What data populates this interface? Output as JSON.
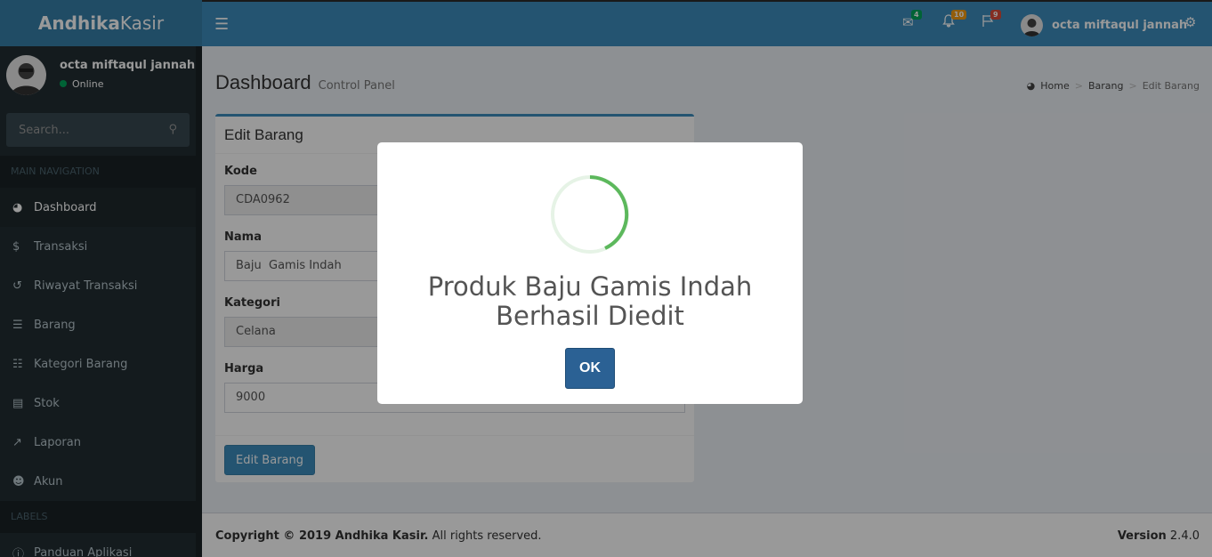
{
  "brand": {
    "bold": "Andhika",
    "light": "Kasir"
  },
  "header": {
    "messages_count": "4",
    "notifications_count": "10",
    "tasks_count": "9",
    "user_name": "octa miftaqul jannah",
    "colors": {
      "messages": "#00a65a",
      "notifications": "#f39c12",
      "tasks": "#dd4b39"
    }
  },
  "sidebar": {
    "user_name": "octa miftaqul jannah",
    "status": "Online",
    "search_placeholder": "Search...",
    "main_nav_label": "MAIN NAVIGATION",
    "items": [
      {
        "label": "Dashboard",
        "icon": "dashboard-icon"
      },
      {
        "label": "Transaksi",
        "icon": "dollar-icon"
      },
      {
        "label": "Riwayat Transaksi",
        "icon": "history-icon"
      },
      {
        "label": "Barang",
        "icon": "database-icon"
      },
      {
        "label": "Kategori Barang",
        "icon": "list-icon"
      },
      {
        "label": "Stok",
        "icon": "book-icon"
      },
      {
        "label": "Laporan",
        "icon": "line-chart-icon"
      },
      {
        "label": "Akun",
        "icon": "users-icon"
      }
    ],
    "labels_header": "LABELS",
    "extra_item": {
      "label": "Panduan Aplikasi",
      "icon": "info-icon"
    }
  },
  "content": {
    "title": "Dashboard",
    "subtitle": "Control Panel",
    "breadcrumb": [
      "Home",
      "Barang",
      "Edit Barang"
    ],
    "box_title": "Edit Barang",
    "fields": [
      {
        "label": "Kode",
        "value": "CDA0962"
      },
      {
        "label": "Nama",
        "value": "Baju  Gamis Indah"
      },
      {
        "label": "Kategori",
        "value": "Celana"
      },
      {
        "label": "Harga",
        "value": "9000"
      }
    ],
    "submit_label": "Edit Barang"
  },
  "footer": {
    "copyright_bold": "Copyright © 2019 Andhika Kasir.",
    "copyright_rest": " All rights reserved.",
    "version_label": "Version",
    "version_value": " 2.4.0"
  },
  "modal": {
    "message": "Produk Baju Gamis Indah Berhasil Diedit",
    "ok_label": "OK",
    "spinner_color": "#5cb85c"
  }
}
